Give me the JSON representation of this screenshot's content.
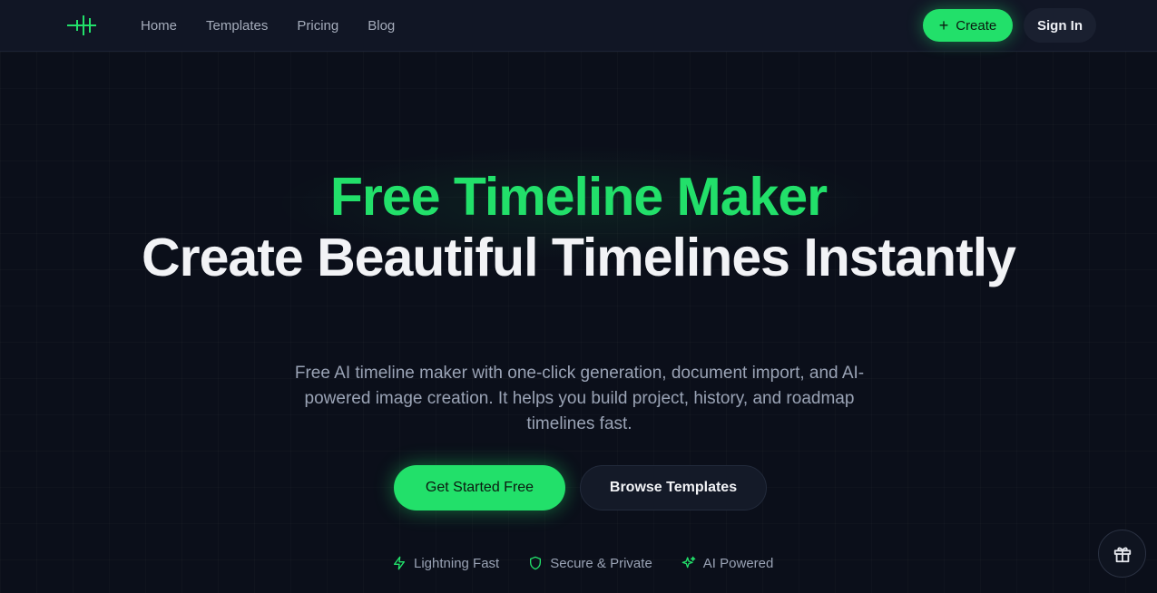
{
  "nav": {
    "logo_icon": "timeline-logo-icon",
    "items": [
      {
        "label": "Home"
      },
      {
        "label": "Templates"
      },
      {
        "label": "Pricing"
      },
      {
        "label": "Blog"
      }
    ],
    "create_label": "Create",
    "signin_label": "Sign In"
  },
  "hero": {
    "title_accent": "Free Timeline Maker",
    "title_main": "Create Beautiful Timelines Instantly",
    "description": "Free AI timeline maker with one-click generation, document import, and AI-powered image creation. It helps you build project, history, and roadmap timelines fast.",
    "cta_primary": "Get Started Free",
    "cta_secondary": "Browse Templates"
  },
  "features": [
    {
      "label": "Lightning Fast",
      "icon": "lightning-icon"
    },
    {
      "label": "Secure & Private",
      "icon": "shield-icon"
    },
    {
      "label": "AI Powered",
      "icon": "sparkles-icon"
    }
  ],
  "colors": {
    "accent": "#22e06a",
    "background": "#0b0f1a",
    "header": "#111625"
  }
}
